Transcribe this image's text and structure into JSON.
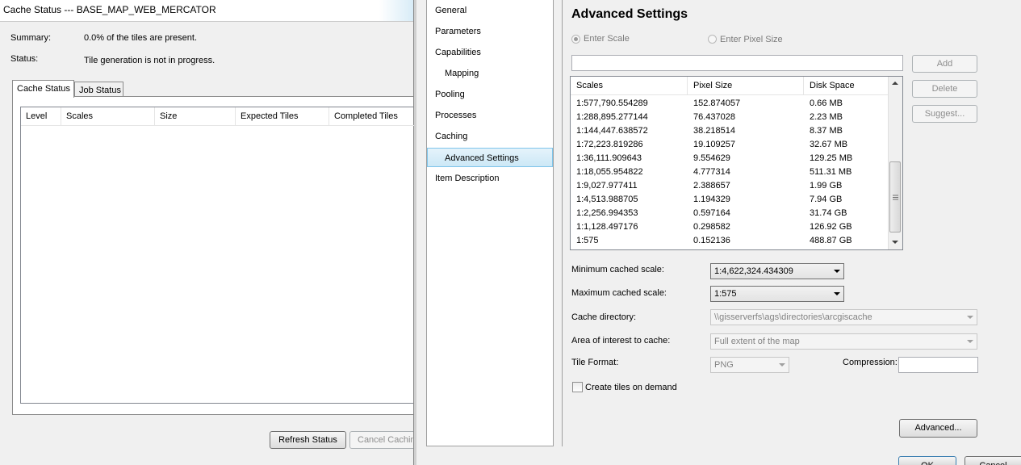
{
  "cache_window": {
    "title": "Cache Status --- BASE_MAP_WEB_MERCATOR",
    "summary_label": "Summary:",
    "summary_value": "0.0% of the tiles are present.",
    "status_label": "Status:",
    "status_value": "Tile generation is not in progress.",
    "tabs": [
      "Cache Status",
      "Job Status"
    ],
    "columns": [
      "Level",
      "Scales",
      "Size",
      "Expected Tiles",
      "Completed Tiles"
    ],
    "refresh_button": "Refresh Status",
    "cancel_button": "Cancel Caching"
  },
  "nav": {
    "items": [
      "General",
      "Parameters",
      "Capabilities",
      "Mapping",
      "Pooling",
      "Processes",
      "Caching",
      "Advanced Settings",
      "Item Description"
    ]
  },
  "settings": {
    "title": "Advanced Settings",
    "enter_scale": "Enter Scale",
    "enter_pixel_size": "Enter Pixel Size",
    "scale_input_value": "",
    "add_button": "Add",
    "delete_button": "Delete",
    "suggest_button": "Suggest...",
    "scales_columns": [
      "Scales",
      "Pixel Size",
      "Disk Space"
    ],
    "scales_rows": [
      [
        "1:577,790.554289",
        "152.874057",
        "0.66 MB"
      ],
      [
        "1:288,895.277144",
        "76.437028",
        "2.23 MB"
      ],
      [
        "1:144,447.638572",
        "38.218514",
        "8.37 MB"
      ],
      [
        "1:72,223.819286",
        "19.109257",
        "32.67 MB"
      ],
      [
        "1:36,111.909643",
        "9.554629",
        "129.25 MB"
      ],
      [
        "1:18,055.954822",
        "4.777314",
        "511.31 MB"
      ],
      [
        "1:9,027.977411",
        "2.388657",
        "1.99 GB"
      ],
      [
        "1:4,513.988705",
        "1.194329",
        "7.94 GB"
      ],
      [
        "1:2,256.994353",
        "0.597164",
        "31.74 GB"
      ],
      [
        "1:1,128.497176",
        "0.298582",
        "126.92 GB"
      ],
      [
        "1:575",
        "0.152136",
        "488.87 GB"
      ]
    ],
    "min_scale_label": "Minimum cached scale:",
    "min_scale_value": "1:4,622,324.434309",
    "max_scale_label": "Maximum cached scale:",
    "max_scale_value": "1:575",
    "cache_dir_label": "Cache directory:",
    "cache_dir_value": "\\\\gisserverfs\\ags\\directories\\arcgiscache",
    "aoi_label": "Area of interest to cache:",
    "aoi_value": "Full extent of the map",
    "tile_format_label": "Tile Format:",
    "tile_format_value": "PNG",
    "compression_label": "Compression:",
    "compression_value": "",
    "create_on_demand_label": "Create tiles on demand",
    "advanced_button": "Advanced...",
    "ok_button": "OK",
    "cancel_button": "Cancel"
  }
}
